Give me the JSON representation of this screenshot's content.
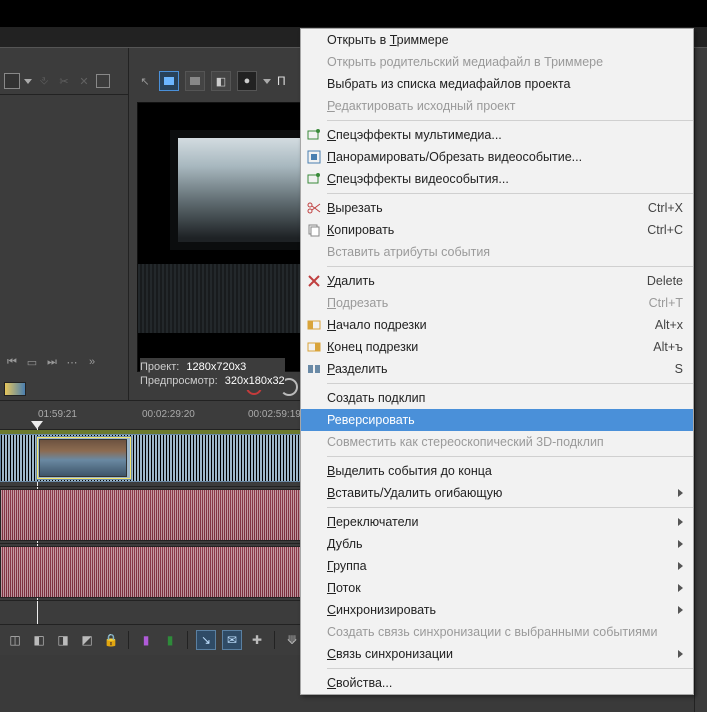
{
  "preview": {
    "toolbar_label": "П",
    "project_label": "Проект:",
    "project_value": "1280x720x3",
    "preview_label": "Предпросмотр:",
    "preview_value": "320x180x32"
  },
  "timeline": {
    "ticks": [
      "01:59:21",
      "00:02:29:20",
      "00:02:59:19"
    ]
  },
  "context_menu": {
    "open_trimmer": {
      "u": "Т",
      "rest": "Открыть в ",
      "tail": "риммере"
    },
    "open_parent": {
      "text": "Открыть родительский медиафайл в Триммере"
    },
    "select_media": {
      "text": "Выбрать из списка медиафайлов проекта"
    },
    "edit_source": {
      "u": "Р",
      "rest": "едактировать исходный проект"
    },
    "fx_media": {
      "u": "С",
      "rest": "пецэффекты мультимедиа..."
    },
    "pan_crop": {
      "u": "П",
      "rest": "анорамировать/Обрезать видеособытие..."
    },
    "fx_video": {
      "u": "С",
      "rest": "пецэффекты видеособытия..."
    },
    "cut": {
      "u": "В",
      "rest": "ырезать",
      "shortcut": "Ctrl+X"
    },
    "copy": {
      "u": "К",
      "rest": "опировать",
      "shortcut": "Ctrl+C"
    },
    "paste_attr": {
      "text": "Вставить атрибуты события"
    },
    "delete": {
      "u": "У",
      "rest": "далить",
      "shortcut": "Delete"
    },
    "trim": {
      "u": "П",
      "rest": "одрезать",
      "shortcut": "Ctrl+T"
    },
    "trim_start": {
      "u": "Н",
      "rest": "ачало подрезки",
      "shortcut": "Alt+х"
    },
    "trim_end": {
      "u": "К",
      "rest": "онец подрезки",
      "shortcut": "Alt+ъ"
    },
    "split": {
      "u": "Р",
      "rest": "азделить",
      "shortcut": "S"
    },
    "subclip": {
      "text": "Создать подклип"
    },
    "reverse": {
      "text": "Реверсировать"
    },
    "stereo3d": {
      "text": "Совместить как стереоскопический 3D-подклип"
    },
    "select_to_end": {
      "u": "В",
      "rest": "ыделить события до конца"
    },
    "envelope": {
      "u": "В",
      "rest": "ставить/Удалить огибающую"
    },
    "switches": {
      "u": "П",
      "rest": "ереключатели"
    },
    "dubl": {
      "u": "Д",
      "rest": "убль"
    },
    "group": {
      "u": "Г",
      "rest": "руппа"
    },
    "stream": {
      "u": "П",
      "rest": "оток"
    },
    "sync": {
      "u": "С",
      "rest": "инхронизировать"
    },
    "sync_link_create": {
      "text": "Создать связь синхронизации с выбранными событиями"
    },
    "sync_link": {
      "u": "С",
      "rest": "вязь синхронизации"
    },
    "properties": {
      "u": "С",
      "rest": "войства..."
    }
  }
}
